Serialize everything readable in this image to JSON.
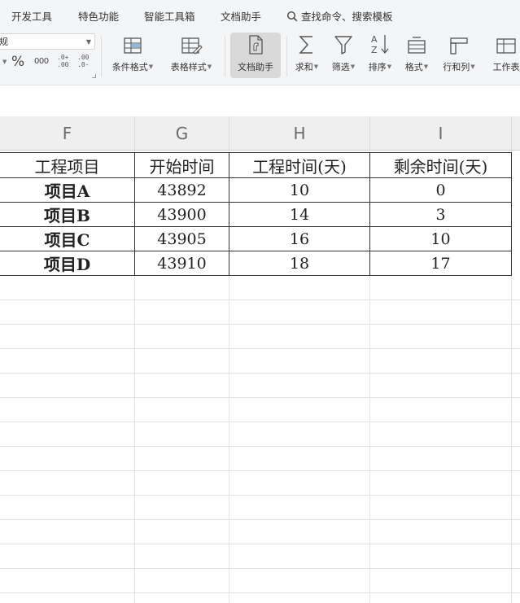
{
  "menu": {
    "items": [
      "开发工具",
      "特色功能",
      "智能工具箱",
      "文档助手"
    ],
    "search_label": "查找命令、搜索模板",
    "search_icon": "search-icon"
  },
  "ribbon": {
    "number_format": "规",
    "number_buttons": {
      "percent": "%",
      "thousands": "000",
      "increase_top": ".0+",
      "increase_bottom": ".00",
      "decrease_top": ".00",
      "decrease_bottom": ".0-"
    },
    "tools": [
      {
        "label": "条件格式",
        "icon": "conditional-format-icon",
        "dropdown": true
      },
      {
        "label": "表格样式",
        "icon": "table-style-icon",
        "dropdown": true
      },
      {
        "label": "文档助手",
        "icon": "document-assistant-icon",
        "dropdown": false
      },
      {
        "label": "求和",
        "icon": "sum-icon",
        "dropdown": true
      },
      {
        "label": "筛选",
        "icon": "filter-icon",
        "dropdown": true
      },
      {
        "label": "排序",
        "icon": "sort-icon",
        "dropdown": true
      },
      {
        "label": "格式",
        "icon": "format-icon",
        "dropdown": true
      },
      {
        "label": "行和列",
        "icon": "rows-columns-icon",
        "dropdown": true
      },
      {
        "label": "工作表",
        "icon": "worksheet-icon",
        "dropdown": false
      }
    ]
  },
  "sheet": {
    "columns": [
      "F",
      "G",
      "H",
      "I"
    ],
    "table": {
      "headers": [
        "工程项目",
        "开始时间",
        "工程时间(天)",
        "剩余时间(天)"
      ],
      "rows": [
        [
          "项目A",
          "43892",
          "10",
          "0"
        ],
        [
          "项目B",
          "43900",
          "14",
          "3"
        ],
        [
          "项目C",
          "43905",
          "16",
          "10"
        ],
        [
          "项目D",
          "43910",
          "18",
          "17"
        ]
      ]
    }
  },
  "colors": {
    "menu_bg": "#f4f5f7",
    "active_tool_bg": "#d9d9d9",
    "header_bg": "#efefef",
    "grid": "#e3e3e3"
  }
}
